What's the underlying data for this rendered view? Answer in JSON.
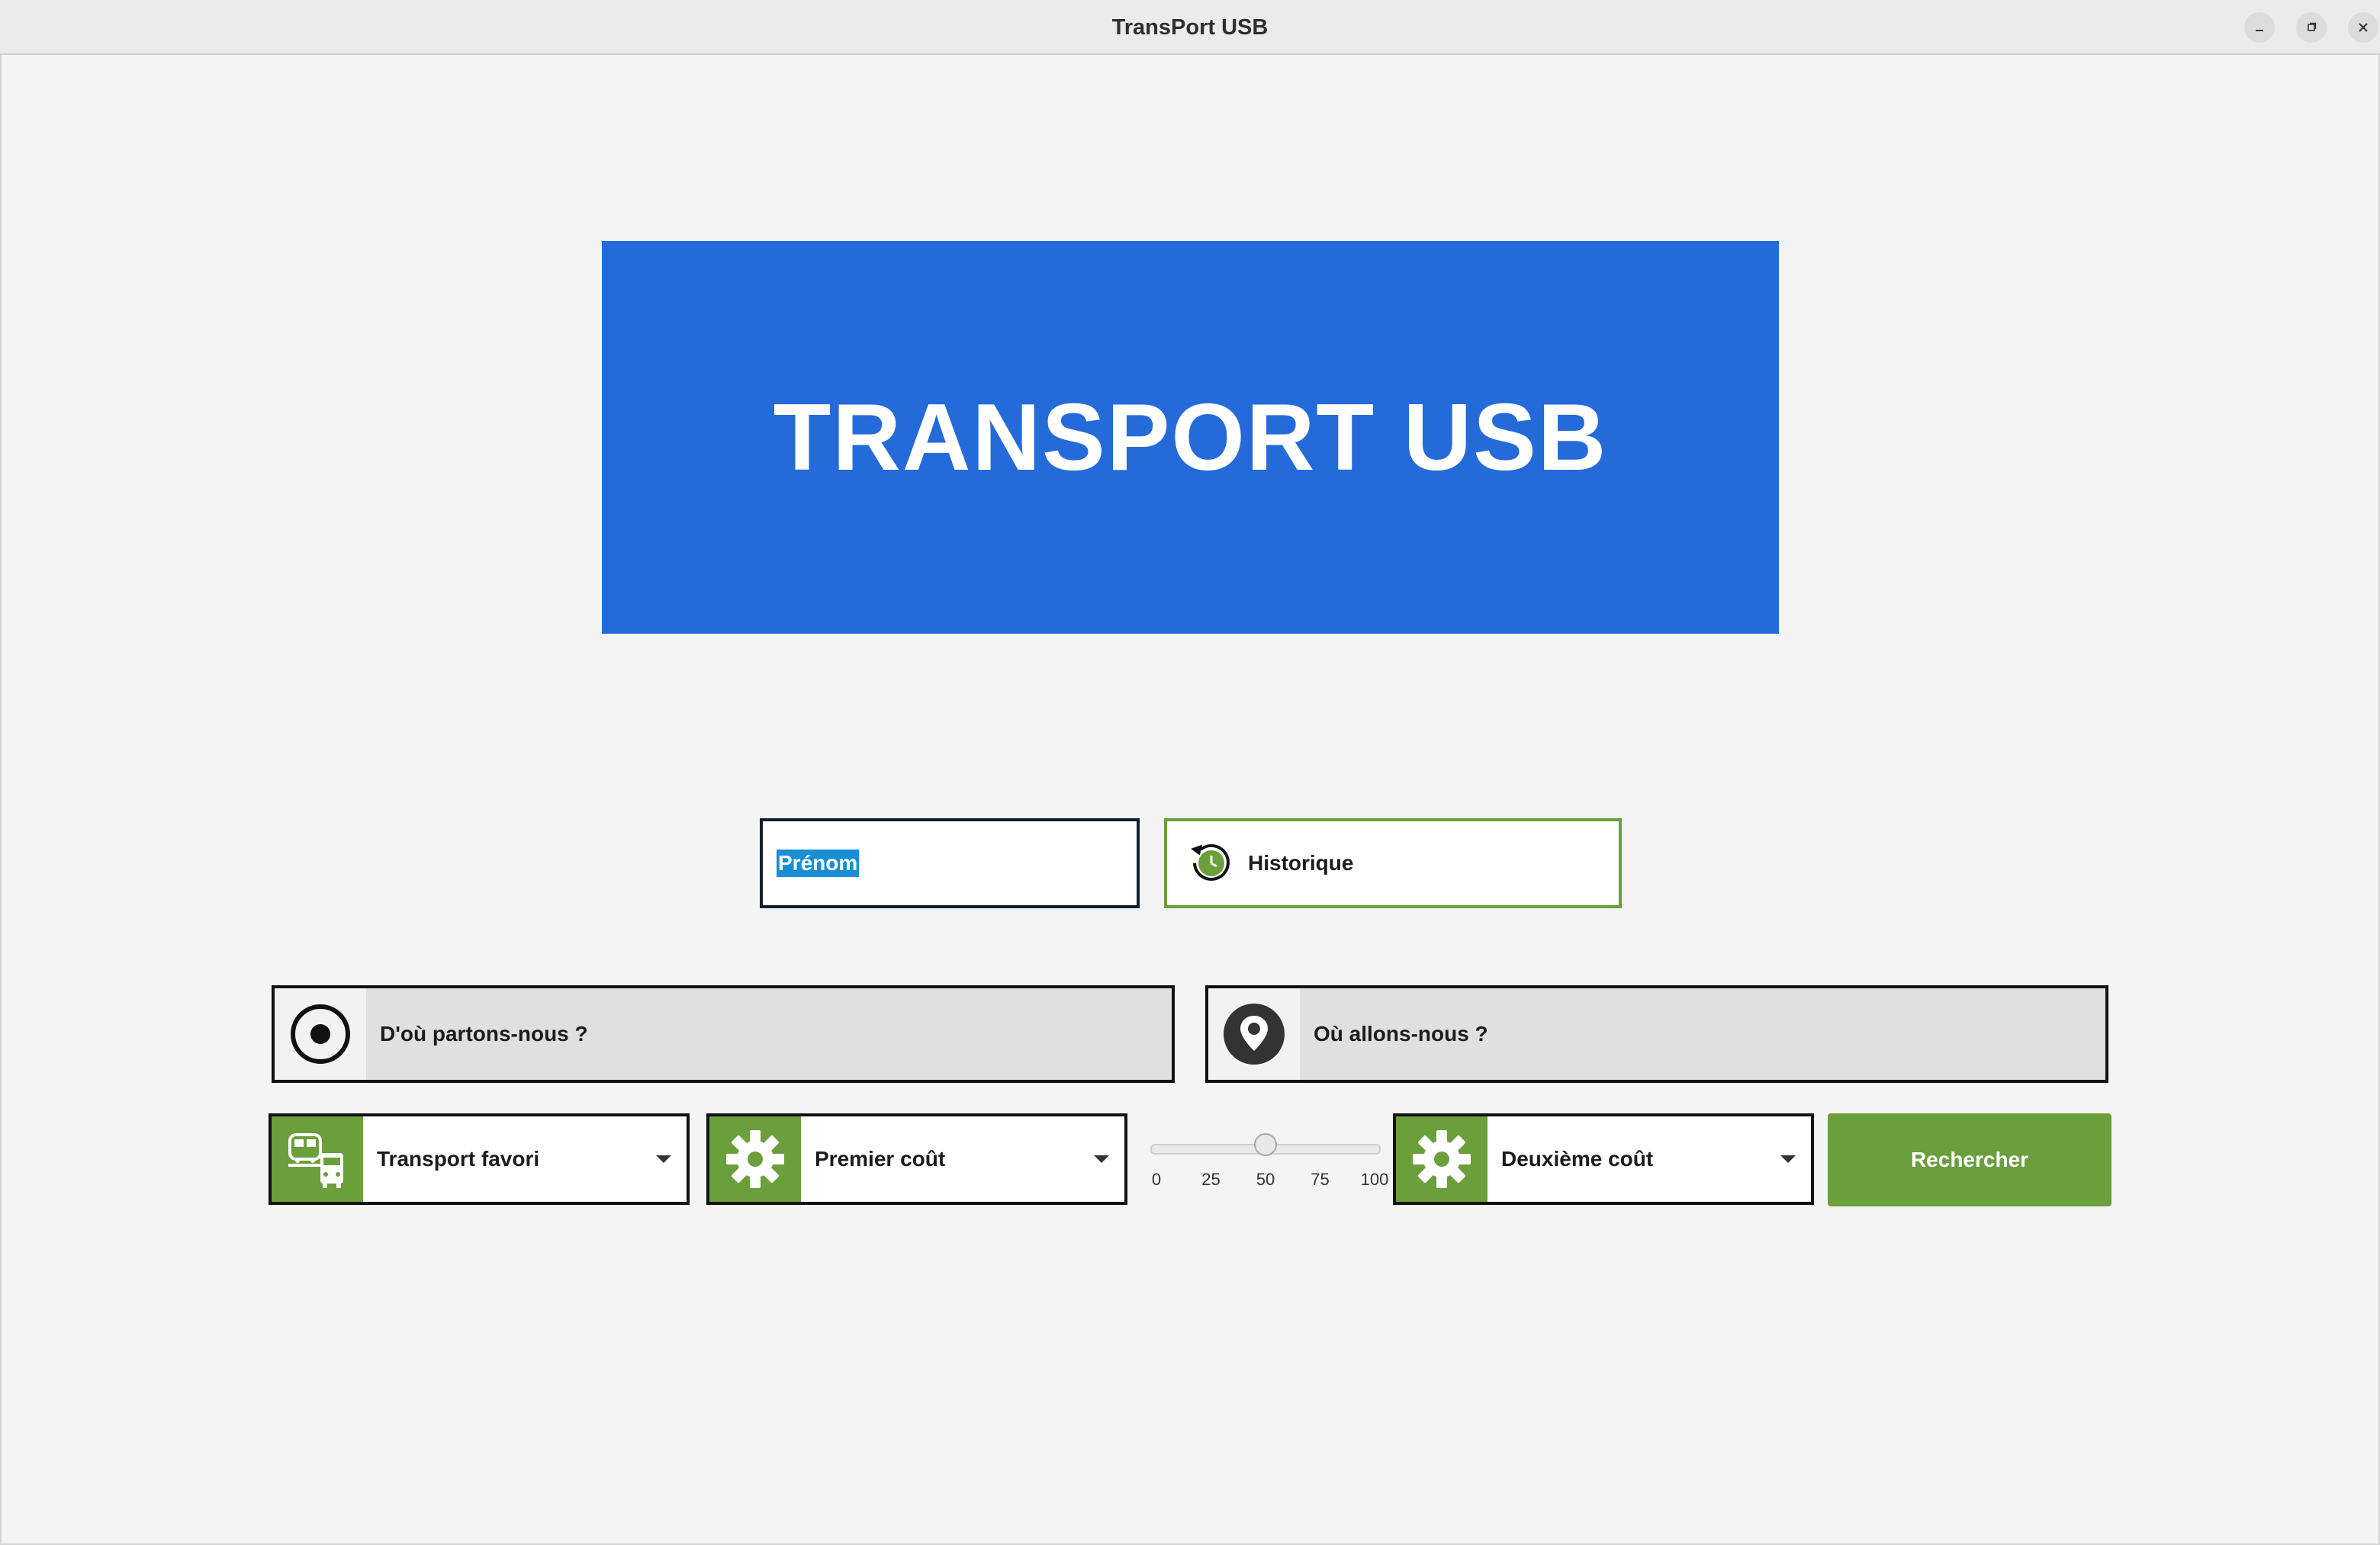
{
  "window": {
    "title": "TransPort USB",
    "controls": [
      "minimize",
      "maximize",
      "close"
    ]
  },
  "banner": {
    "text": "TRANSPORT USB"
  },
  "name_field": {
    "value": "Prénom",
    "selected": true
  },
  "history_button": {
    "label": "Historique",
    "icon": "history-clock-icon"
  },
  "origin_field": {
    "placeholder": "D'où partons-nous ?",
    "icon": "radio-target-icon"
  },
  "destination_field": {
    "placeholder": "Où allons-nous ?",
    "icon": "location-pin-icon"
  },
  "transport_select": {
    "selected": "Transport favori",
    "icon": "train-bus-icon"
  },
  "first_cost_select": {
    "selected": "Premier coût",
    "icon": "gear-icon"
  },
  "cost_slider": {
    "min": 0,
    "max": 100,
    "value": 50,
    "ticks": [
      "0",
      "25",
      "50",
      "75",
      "100"
    ]
  },
  "second_cost_select": {
    "selected": "Deuxième coût",
    "icon": "gear-icon"
  },
  "search_button": {
    "label": "Rechercher"
  },
  "colors": {
    "banner": "#246bd9",
    "accent_green": "#6a9f3c",
    "selection": "#1a8ed3",
    "background": "#f4f4f4"
  }
}
